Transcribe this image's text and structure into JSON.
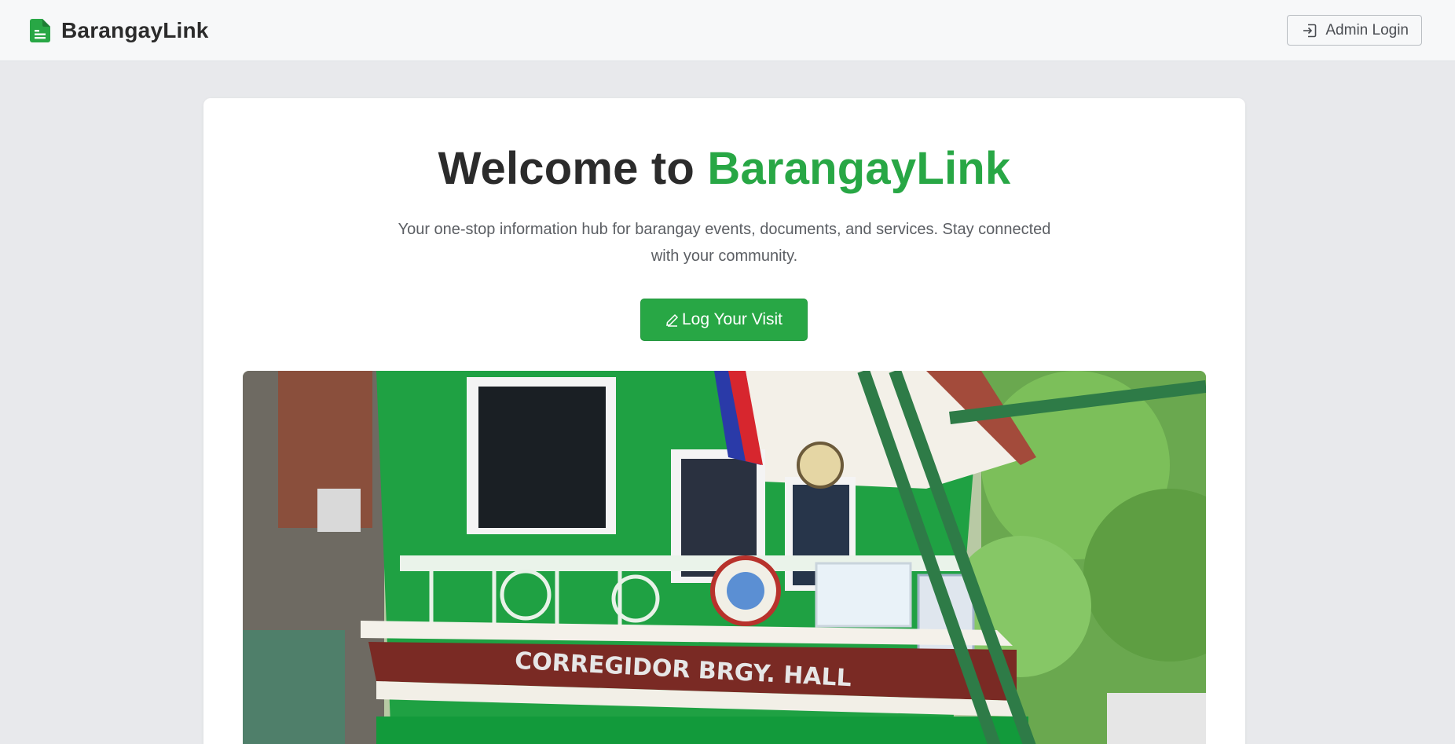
{
  "navbar": {
    "brand_name": "BarangayLink",
    "logo_icon": "document-icon",
    "admin_login_label": "Admin Login",
    "admin_login_icon": "sign-in-icon"
  },
  "hero": {
    "title_prefix": "Welcome to ",
    "title_accent": "BarangayLink",
    "subtitle": "Your one-stop information hub for barangay events, documents, and services. Stay connected with your community.",
    "cta_label": "Log Your Visit",
    "cta_icon": "pencil-icon"
  },
  "photo": {
    "sign_text": "CORREGIDOR BRGY. HALL"
  },
  "colors": {
    "accent": "#28a745",
    "page_bg": "#e8e9ec",
    "text_dark": "#2b2b2b"
  }
}
